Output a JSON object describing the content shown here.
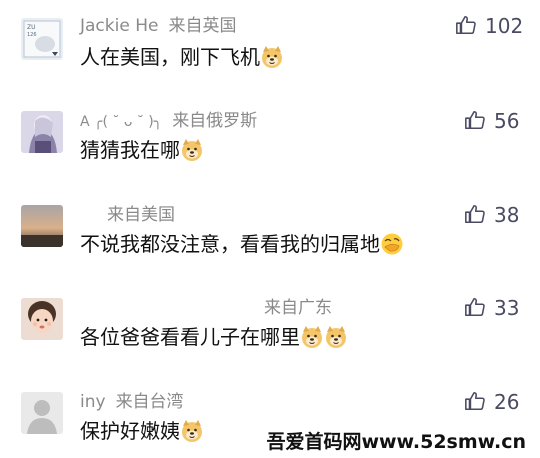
{
  "comments": [
    {
      "username": "Jackie He",
      "location": "来自英国",
      "text": "人在美国，刚下飞机",
      "likes": "102",
      "emojis": 1
    },
    {
      "username": "A ╭( ˘ ᴗ ˘ )╮",
      "location": "来自俄罗斯",
      "text": "猜猜我在哪",
      "likes": "56",
      "emojis": 1
    },
    {
      "username": "",
      "location": "来自美国",
      "text": "不说我都没注意，看看我的归属地",
      "likes": "38",
      "emojis": 1
    },
    {
      "username": "",
      "location": "来自广东",
      "text": "各位爸爸看看儿子在哪里",
      "likes": "33",
      "emojis": 2
    },
    {
      "username": "iny",
      "location": "来自台湾",
      "text": "保护好嫩姨",
      "likes": "26",
      "emojis": 1
    }
  ],
  "watermark": "吾爱首码网www.52smw.cn",
  "colors": {
    "meta_gray": "#8a8a8a",
    "text": "#111111",
    "like_icon": "#4a4a62"
  },
  "icons": {
    "like": "thumbs-up-icon",
    "emoji_doge": "doge-emoji-icon",
    "emoji_facepalm": "facepalm-emoji-icon"
  }
}
